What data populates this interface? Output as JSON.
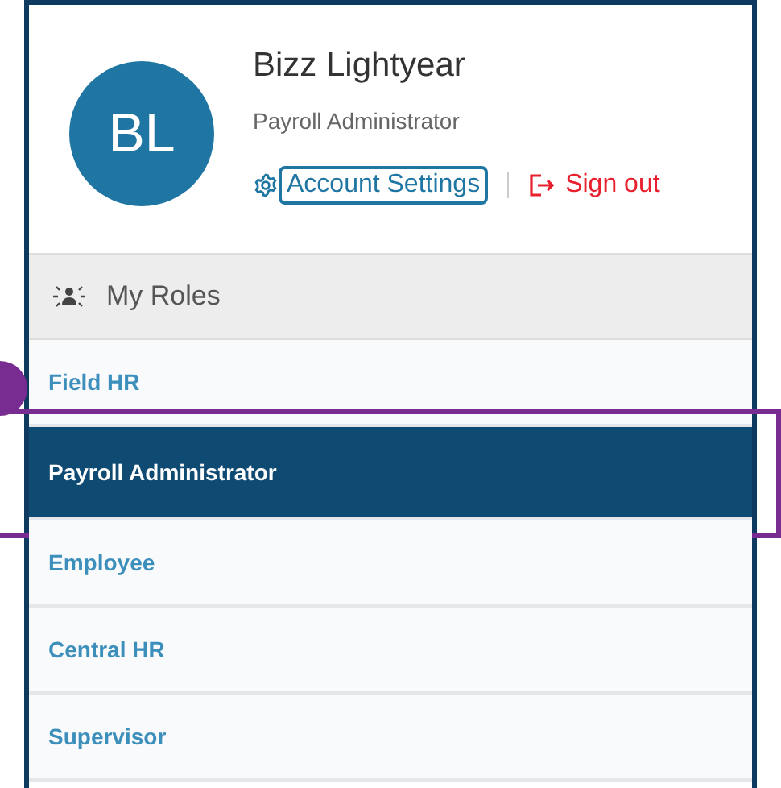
{
  "user": {
    "initials": "BL",
    "name": "Bizz Lightyear",
    "role": "Payroll Administrator"
  },
  "links": [
    {
      "kind": "settings",
      "label": "Account Settings",
      "focused": true
    },
    {
      "kind": "signout",
      "label": "Sign out",
      "focused": false
    }
  ],
  "roles_header": "My Roles",
  "roles": [
    {
      "label": "Field HR",
      "selected": false
    },
    {
      "label": "Payroll Administrator",
      "selected": true,
      "highlighted": true
    },
    {
      "label": "Employee",
      "selected": false
    },
    {
      "label": "Central HR",
      "selected": false
    },
    {
      "label": "Supervisor",
      "selected": false
    }
  ]
}
